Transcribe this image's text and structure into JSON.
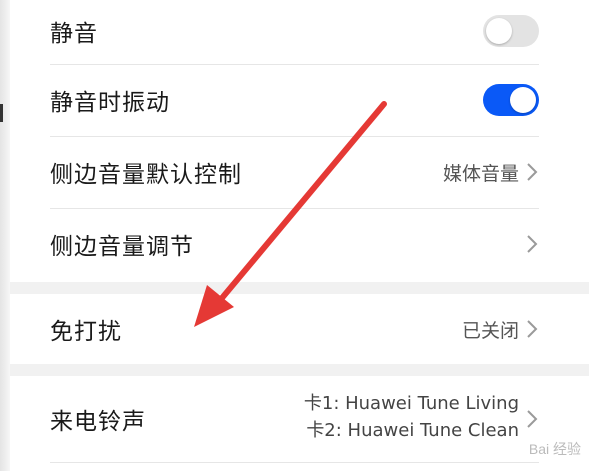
{
  "settings": {
    "group1": [
      {
        "label": "静音",
        "type": "toggle",
        "on": false
      },
      {
        "label": "静音时振动",
        "type": "toggle",
        "on": true
      },
      {
        "label": "侧边音量默认控制",
        "value": "媒体音量",
        "icon": "chevron-right-icon"
      },
      {
        "label": "侧边音量调节",
        "value": "",
        "icon": "chevron-right-icon"
      }
    ],
    "dnd": {
      "label": "免打扰",
      "value": "已关闭",
      "icon": "chevron-right-icon"
    },
    "ringtone": {
      "label": "来电铃声",
      "line1": "卡1: Huawei Tune Living",
      "line2": "卡2: Huawei Tune Clean",
      "icon": "chevron-right-icon"
    }
  },
  "colors": {
    "accent": "#0a59f7",
    "toggle_off": "#e3e3e3",
    "arrow": "#e53935",
    "background": "#f1f1f1"
  },
  "annotation": {
    "type": "arrow",
    "color": "#e53935",
    "icon": "red-arrow-annotation"
  },
  "watermark": {
    "text": "Bai 经验"
  }
}
